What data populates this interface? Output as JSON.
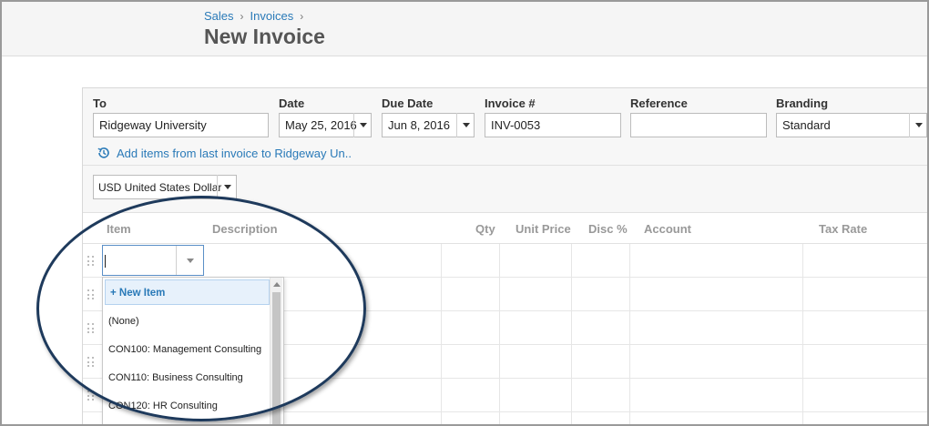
{
  "breadcrumb": {
    "items": [
      "Sales",
      "Invoices"
    ],
    "separator": "›"
  },
  "page": {
    "title": "New Invoice"
  },
  "form": {
    "to": {
      "label": "To",
      "value": "Ridgeway University"
    },
    "date": {
      "label": "Date",
      "value": "May 25, 2016"
    },
    "due_date": {
      "label": "Due Date",
      "value": "Jun 8, 2016"
    },
    "invoice_no": {
      "label": "Invoice #",
      "value": "INV-0053"
    },
    "reference": {
      "label": "Reference",
      "value": ""
    },
    "branding": {
      "label": "Branding",
      "value": "Standard"
    },
    "add_items_link": "Add items from last invoice to Ridgeway Un..",
    "currency": "USD United States Dollar"
  },
  "table": {
    "headers": [
      "Item",
      "Description",
      "Qty",
      "Unit Price",
      "Disc %",
      "Account",
      "Tax Rate"
    ]
  },
  "item_dropdown": {
    "options": [
      "+ New Item",
      "(None)",
      "CON100: Management Consulting",
      "CON110: Business Consulting",
      "CON120: HR Consulting"
    ]
  },
  "colors": {
    "link": "#2a7ab8",
    "highlight": "#1e3a5c"
  }
}
